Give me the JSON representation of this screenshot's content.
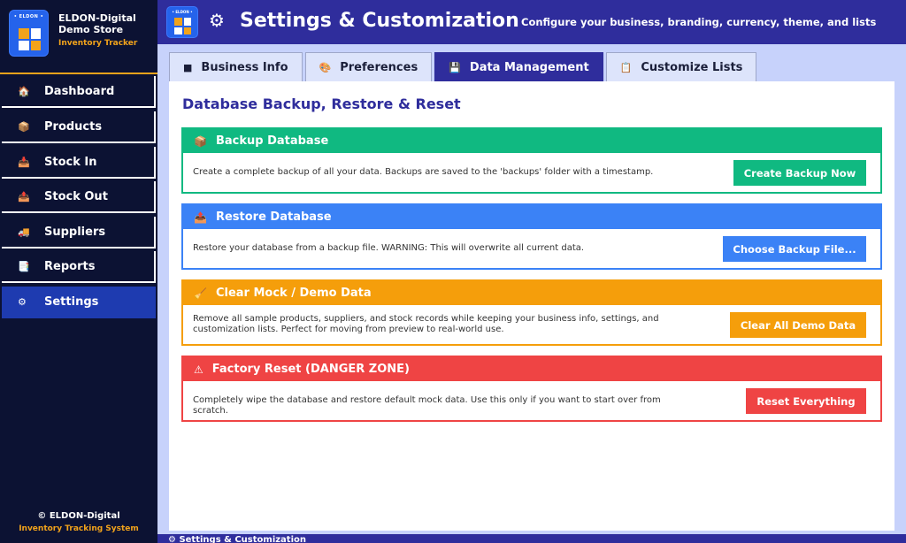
{
  "brand": {
    "logo_text": "• ELDON •",
    "title": "ELDON-Digital Demo Store",
    "subtitle": "Inventory Tracker"
  },
  "sidebar": {
    "items": [
      {
        "label": "Dashboard",
        "icon": "🏠"
      },
      {
        "label": "Products",
        "icon": "📦"
      },
      {
        "label": "Stock In",
        "icon": "📥"
      },
      {
        "label": "Stock Out",
        "icon": "📤"
      },
      {
        "label": "Suppliers",
        "icon": "🚚"
      },
      {
        "label": "Reports",
        "icon": "📑"
      },
      {
        "label": "Settings",
        "icon": "⚙"
      }
    ],
    "footer_line1": "© ELDON-Digital",
    "footer_line2": "Inventory Tracking System"
  },
  "header": {
    "logo_text": "• ELDON •",
    "icon": "⚙",
    "title": "Settings & Customization",
    "subtitle": "Configure your business, branding, currency, theme, and lists"
  },
  "tabs": [
    {
      "label": "Business Info",
      "icon": "■"
    },
    {
      "label": "Preferences",
      "icon": "🎨"
    },
    {
      "label": "Data Management",
      "icon": "💾"
    },
    {
      "label": "Customize Lists",
      "icon": "📋"
    }
  ],
  "panel": {
    "title": "Database Backup, Restore & Reset",
    "cards": [
      {
        "title": "Backup Database",
        "icon": "📦",
        "description": "Create a complete backup of all your data. Backups are saved to the 'backups' folder with a timestamp.",
        "button": "Create Backup Now",
        "color": "#10b981"
      },
      {
        "title": "Restore Database",
        "icon": "📤",
        "description": "Restore your database from a backup file. WARNING: This will overwrite all current data.",
        "button": "Choose Backup File...",
        "color": "#3b82f6"
      },
      {
        "title": "Clear Mock / Demo Data",
        "icon": "🧹",
        "description": "Remove all sample products, suppliers, and stock records while keeping your business info, settings, and customization lists. Perfect for moving from preview to real-world use.",
        "button": "Clear All Demo Data",
        "color": "#f59e0b"
      },
      {
        "title": "Factory Reset (DANGER ZONE)",
        "icon": "⚠",
        "description": "Completely wipe the database and restore default mock data. Use this only if you want to start over from scratch.",
        "button": "Reset Everything",
        "color": "#ef4444"
      }
    ]
  },
  "bottom_bar": "⚙ Settings & Customization"
}
